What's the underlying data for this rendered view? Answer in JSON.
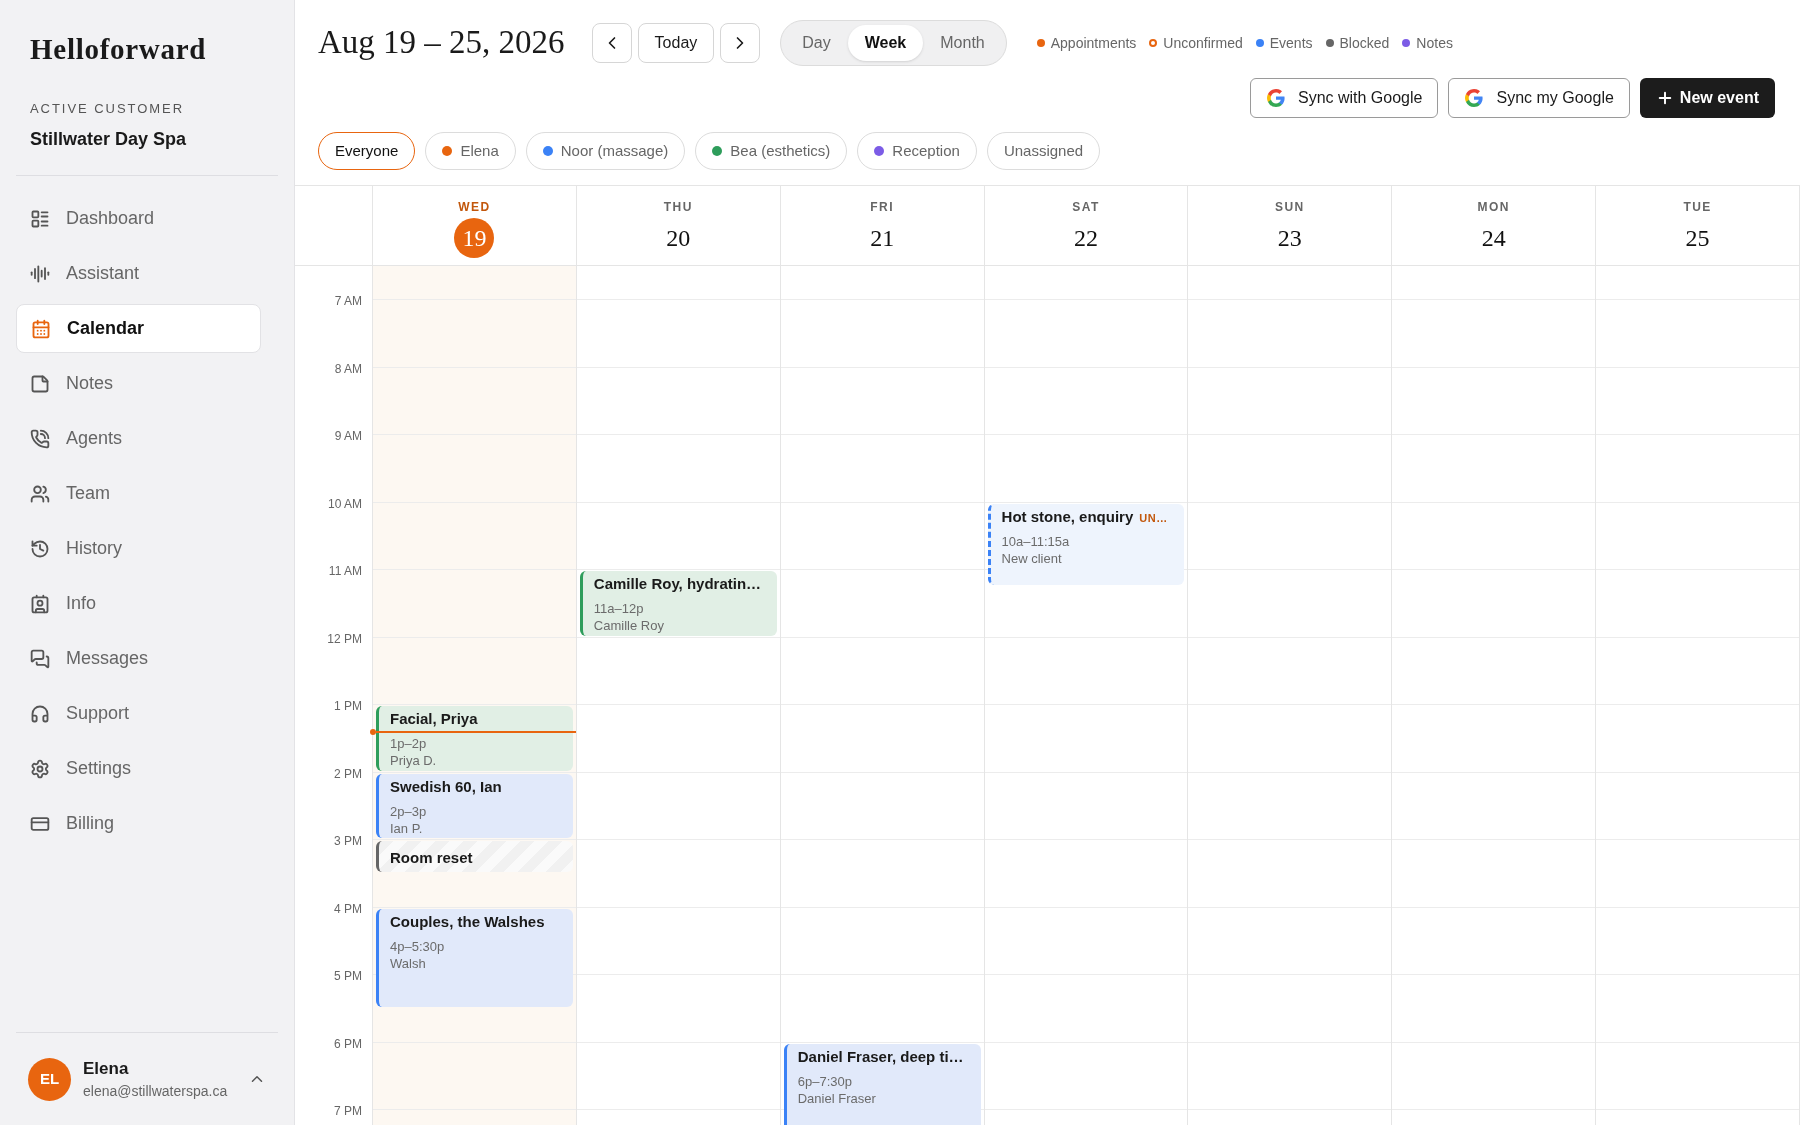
{
  "sidebar": {
    "logo": "Helloforward",
    "customer_label": "ACTIVE CUSTOMER",
    "customer_name": "Stillwater Day Spa",
    "items": [
      {
        "label": "Dashboard",
        "selected": false
      },
      {
        "label": "Assistant",
        "selected": false
      },
      {
        "label": "Calendar",
        "selected": true
      },
      {
        "label": "Notes",
        "selected": false
      },
      {
        "label": "Agents",
        "selected": false
      },
      {
        "label": "Team",
        "selected": false
      },
      {
        "label": "History",
        "selected": false
      },
      {
        "label": "Info",
        "selected": false
      },
      {
        "label": "Messages",
        "selected": false
      },
      {
        "label": "Support",
        "selected": false
      },
      {
        "label": "Settings",
        "selected": false
      },
      {
        "label": "Billing",
        "selected": false
      }
    ],
    "user": {
      "initials": "EL",
      "name": "Elena",
      "email": "elena@stillwaterspa.ca"
    }
  },
  "header": {
    "title": "Aug 19 – 25, 2026",
    "today_button": "Today",
    "views": [
      {
        "label": "Day",
        "selected": false
      },
      {
        "label": "Week",
        "selected": true
      },
      {
        "label": "Month",
        "selected": false
      }
    ],
    "legend": [
      {
        "label": "Appointments",
        "kind": "dot",
        "color": "#e8650f"
      },
      {
        "label": "Unconfirmed",
        "kind": "ring",
        "color": "#e8650f"
      },
      {
        "label": "Events",
        "kind": "dot",
        "color": "#3b82f6"
      },
      {
        "label": "Blocked",
        "kind": "dot",
        "color": "#666666"
      },
      {
        "label": "Notes",
        "kind": "dot",
        "color": "#7c5ce6"
      }
    ],
    "actions": [
      {
        "label": "Sync with Google",
        "kind": "google"
      },
      {
        "label": "Sync my Google",
        "kind": "google"
      },
      {
        "label": "New event",
        "kind": "primary"
      }
    ],
    "filters": [
      {
        "label": "Everyone",
        "selected": true
      },
      {
        "label": "Elena",
        "selected": false,
        "color": "#e8650f"
      },
      {
        "label": "Noor (massage)",
        "selected": false,
        "color": "#3b82f6"
      },
      {
        "label": "Bea (esthetics)",
        "selected": false,
        "color": "#2e9d5b"
      },
      {
        "label": "Reception",
        "selected": false,
        "color": "#7c5ce6"
      },
      {
        "label": "Unassigned",
        "selected": false
      }
    ]
  },
  "hours": [
    "7 AM",
    "8 AM",
    "9 AM",
    "10 AM",
    "11 AM",
    "12 PM",
    "1 PM",
    "2 PM",
    "3 PM",
    "4 PM",
    "5 PM",
    "6 PM",
    "7 PM"
  ],
  "days": [
    {
      "weekday": "WED",
      "date": "19",
      "selected": true,
      "events": [
        {
          "title": "Facial, Priya",
          "time": "1p–2p",
          "who": "Priya D.",
          "kind": "appointment",
          "color": "#2e9d5b"
        },
        {
          "title": "Swedish 60, Ian",
          "time": "2p–3p",
          "who": "Ian P.",
          "kind": "appointment",
          "color": "#3b82f6"
        },
        {
          "title": "Room reset",
          "kind": "blocked",
          "color": "#666666"
        },
        {
          "title": "Couples, the Walshes",
          "time": "4p–5:30p",
          "who": "Walsh",
          "kind": "appointment",
          "color": "#3b82f6"
        }
      ]
    },
    {
      "weekday": "THU",
      "date": "20",
      "selected": false,
      "events": [
        {
          "title": "Camille Roy, hydratin…",
          "time": "11a–12p",
          "who": "Camille Roy",
          "kind": "appointment",
          "color": "#2e9d5b"
        }
      ]
    },
    {
      "weekday": "FRI",
      "date": "21",
      "selected": false,
      "events": [
        {
          "title": "Daniel Fraser, deep ti…",
          "time": "6p–7:30p",
          "who": "Daniel Fraser",
          "kind": "appointment",
          "color": "#3b82f6"
        }
      ]
    },
    {
      "weekday": "SAT",
      "date": "22",
      "selected": false,
      "events": [
        {
          "title": "Hot stone, enquiry",
          "badge": "UN…",
          "time": "10a–11:15a",
          "who": "New client",
          "kind": "unconfirmed",
          "color": "#3b82f6"
        }
      ]
    },
    {
      "weekday": "SUN",
      "date": "23",
      "selected": false
    },
    {
      "weekday": "MON",
      "date": "24",
      "selected": false
    },
    {
      "weekday": "TUE",
      "date": "25",
      "selected": false
    }
  ]
}
